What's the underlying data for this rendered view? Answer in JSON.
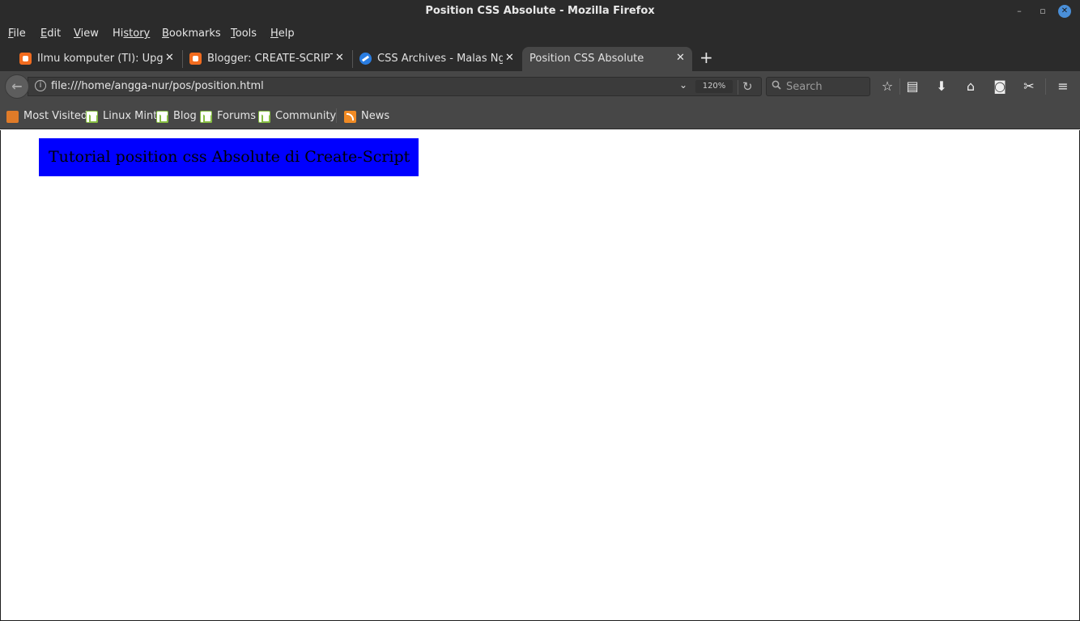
{
  "window": {
    "title": "Position CSS Absolute - Mozilla Firefox",
    "controls": [
      "minimize-icon",
      "maximize-icon",
      "close-icon"
    ]
  },
  "menubar": {
    "items": [
      {
        "label_ul": "F",
        "label_rest": "ile"
      },
      {
        "label_ul": "E",
        "label_rest": "dit"
      },
      {
        "label_ul": "V",
        "label_rest": "iew"
      },
      {
        "label_ul": "Hi",
        "label_rest": "story",
        "ul_pos": "prefix2"
      },
      {
        "label_ul": "B",
        "label_rest": "ookmarks"
      },
      {
        "label_ul": "T",
        "label_rest": "ools"
      },
      {
        "label_ul": "H",
        "label_rest": "elp"
      }
    ]
  },
  "tabs": [
    {
      "label": "Ilmu komputer (TI): Upgrad",
      "icon": "blogger-icon",
      "active": false
    },
    {
      "label": "Blogger: CREATE-SCRIPT - A",
      "icon": "blogger-icon",
      "active": false
    },
    {
      "label": "CSS Archives - Malas Ngodi",
      "icon": "malas-ngoding-icon",
      "active": false
    },
    {
      "label": "Position CSS Absolute",
      "icon": "none",
      "active": true
    }
  ],
  "navbar": {
    "url": "file:///home/angga-nur/pos/position.html",
    "zoom": "120%",
    "search_placeholder": "Search",
    "tools": [
      "bookmark-star-icon",
      "reading-list-icon",
      "downloads-icon",
      "home-icon",
      "pocket-icon",
      "screenshot-icon",
      "hamburger-menu-icon"
    ]
  },
  "bookmarks": [
    {
      "label": "Most Visited",
      "icon": "folder-icon"
    },
    {
      "label": "Linux Mint",
      "icon": "linux-mint-icon"
    },
    {
      "label": "Blog",
      "icon": "linux-mint-icon"
    },
    {
      "label": "Forums",
      "icon": "linux-mint-icon"
    },
    {
      "label": "Community",
      "icon": "linux-mint-icon"
    },
    {
      "label": "News",
      "icon": "rss-icon"
    }
  ],
  "page": {
    "box_text": "Tutorial position css Absolute di Create-Script",
    "box_color": "#0000ff",
    "text_color": "#000000"
  }
}
